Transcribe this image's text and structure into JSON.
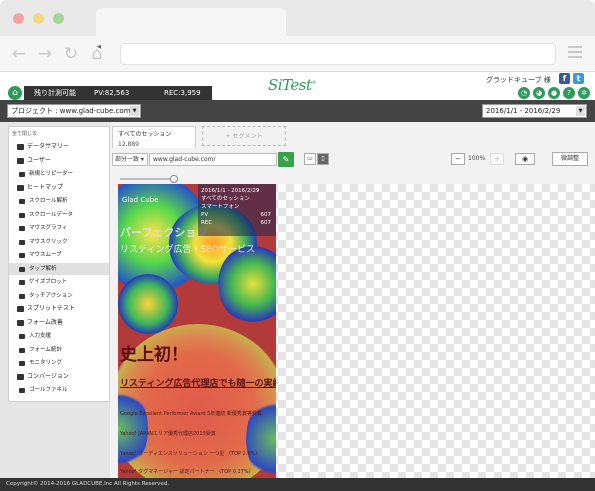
{
  "app": {
    "logo_text": "SiTest",
    "logo_mark": "®",
    "user_name": "グラッドキューブ 様",
    "quota_label": "残り計測可能",
    "pv_label": "PV:82,563",
    "rec_label": "REC:3,959",
    "brand_color": "#2e9a5e"
  },
  "project": {
    "label": "プロジェクト : www.glad-cube.com",
    "date_range": "2016/1/1 - 2016/2/29"
  },
  "sidebar": {
    "collapse_all": "全て閉じる",
    "items": [
      {
        "label": "データサマリー",
        "level": 1
      },
      {
        "label": "ユーザー",
        "level": 1
      },
      {
        "label": "新規とリピーター",
        "level": 2
      },
      {
        "label": "ヒートマップ",
        "level": 1
      },
      {
        "label": "スクロール解析",
        "level": 2
      },
      {
        "label": "スクロールデータ",
        "level": 2
      },
      {
        "label": "マウスグラフィ",
        "level": 2
      },
      {
        "label": "マウスクリック",
        "level": 2
      },
      {
        "label": "マウスムーブ",
        "level": 2
      },
      {
        "label": "タップ解析",
        "level": 2,
        "active": true
      },
      {
        "label": "ゲイズプロット",
        "level": 2
      },
      {
        "label": "タッチアクション",
        "level": 2
      },
      {
        "label": "スプリットテスト",
        "level": 1
      },
      {
        "label": "フォーム改善",
        "level": 1
      },
      {
        "label": "入力支援",
        "level": 2
      },
      {
        "label": "フォーム統計",
        "level": 2
      },
      {
        "label": "モニタリング",
        "level": 2
      },
      {
        "label": "コンバージョン",
        "level": 1
      },
      {
        "label": "ゴールファネル",
        "level": 2
      }
    ]
  },
  "segments": {
    "active_label": "すべてのセッション",
    "active_count": "12,889",
    "add_label": "+ セグメント"
  },
  "filter": {
    "match_type": "部分一致 ▾",
    "url_value": "www.glad-cube.com/"
  },
  "view": {
    "zoom_level": "100%",
    "adjust_label": "微調整"
  },
  "heatmap_page": {
    "overlay_date": "2016/1/1 - 2016/2/29",
    "overlay_segment": "すべてのセッション",
    "overlay_device": "スマートフォン",
    "overlay_pv_label": "PV",
    "overlay_pv": "607",
    "overlay_rec_label": "REC",
    "overlay_rec": "607",
    "brand_text": "Glad Cube",
    "headline_a": "パーフェクション",
    "headline_b": "リスティング広告・SEOサービス",
    "headline_c": "史上初！",
    "headline_d": "リスティング広告代理店でも随一の実績",
    "line1": "Google Excellent Performer Award 5年連続 新優秀賞等受賞",
    "line2": "Yahoo! JAPANエリア優秀代理店2013受賞",
    "line3": "Yahoo! オーディエンスソリューション 一つ星 （TOP 2.6%）",
    "line4": "Yahoo! タグマネージャー 認定パートナー （TOP 0.17%）"
  },
  "footer": {
    "copyright": "Copyright© 2014-2016 GLADCUBE.Inc All Rights Reserved."
  }
}
